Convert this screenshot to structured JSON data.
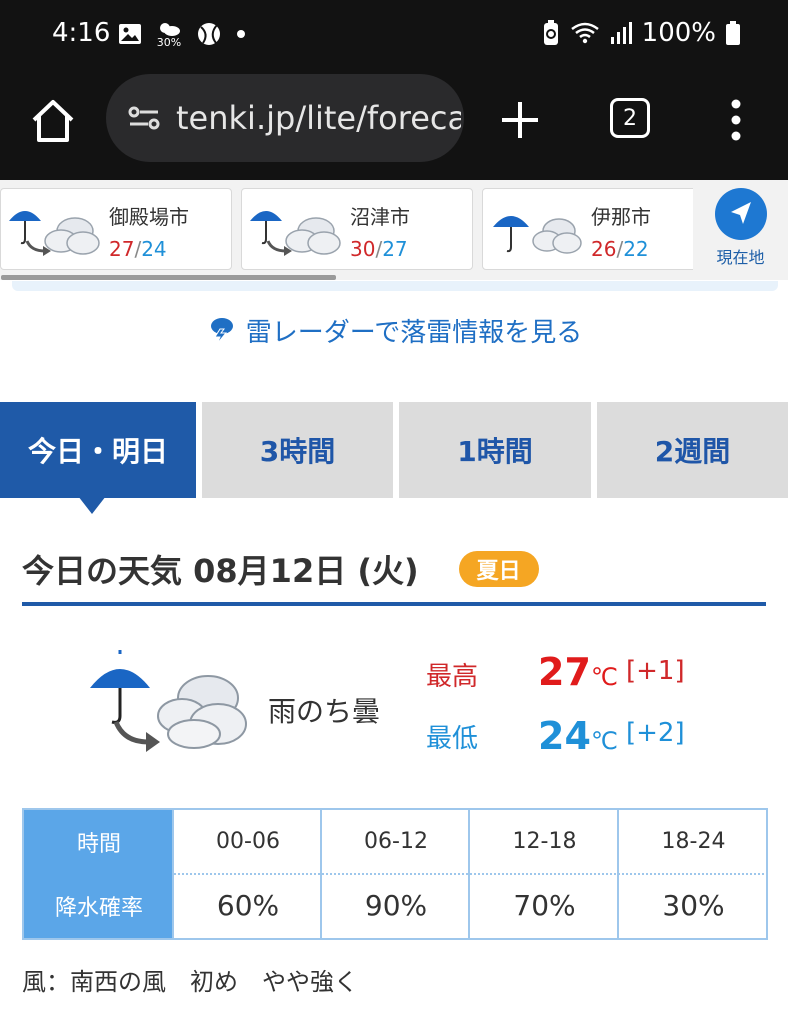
{
  "status_bar": {
    "time": "4:16",
    "badge_percent": "30%",
    "battery": "100%",
    "icons": [
      "gallery-icon",
      "weather-icon",
      "sports-ball-icon",
      "notification-dot-icon",
      "battery-saver-icon",
      "wifi-icon",
      "signal-icon",
      "battery-icon"
    ]
  },
  "browser": {
    "url": "tenki.jp/lite/forecast",
    "tab_count": "2"
  },
  "locations": [
    {
      "name": "御殿場市",
      "high": "27",
      "low": "24"
    },
    {
      "name": "沼津市",
      "high": "30",
      "low": "27"
    },
    {
      "name": "伊那市",
      "high": "26",
      "low": "22"
    }
  ],
  "current_location_label": "現在地",
  "radar_link": "雷レーダーで落雷情報を見る",
  "tabs": [
    {
      "label": "今日・明日",
      "active": true
    },
    {
      "label": "3時間",
      "active": false
    },
    {
      "label": "1時間",
      "active": false
    },
    {
      "label": "2週間",
      "active": false
    }
  ],
  "today": {
    "title": "今日の天気 08月12日 (火)",
    "badge": "夏日",
    "weather": "雨のち曇",
    "high_label": "最高",
    "low_label": "最低",
    "high_temp": "27",
    "low_temp": "24",
    "unit": "℃",
    "high_diff": "[+1]",
    "low_diff": "[+2]"
  },
  "precip": {
    "time_header": "時間",
    "rate_header": "降水確率",
    "periods": [
      "00-06",
      "06-12",
      "12-18",
      "18-24"
    ],
    "rates": [
      "60%",
      "90%",
      "70%",
      "30%"
    ]
  },
  "wind": "風：南西の風　初め　やや強く",
  "colors": {
    "brand_blue": "#1f5aa8",
    "high_red": "#d0282a",
    "low_blue": "#1f90d8",
    "badge_orange": "#f5a623",
    "table_header": "#5ba6e8"
  }
}
